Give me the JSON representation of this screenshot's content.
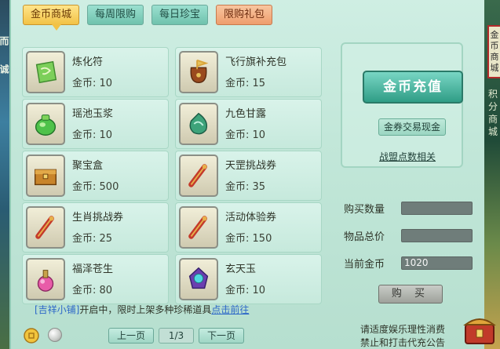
{
  "edges": {
    "left_deco_top": "而",
    "left_deco_mid": "诚",
    "right_tag": "金币商城",
    "right_strip": "积分商城"
  },
  "tabs": [
    {
      "label": "金币商城",
      "state": "active"
    },
    {
      "label": "每周限购",
      "state": "normal"
    },
    {
      "label": "每日珍宝",
      "state": "normal"
    },
    {
      "label": "限购礼包",
      "state": "highlight"
    }
  ],
  "currency_label": "金币:",
  "items": [
    {
      "name": "炼化符",
      "price": "10",
      "icon": "green-talisman-icon"
    },
    {
      "name": "飞行旗补充包",
      "price": "15",
      "icon": "flag-pouch-icon"
    },
    {
      "name": "瑶池玉浆",
      "price": "10",
      "icon": "green-jade-jar-icon"
    },
    {
      "name": "九色甘露",
      "price": "10",
      "icon": "nine-color-dew-icon"
    },
    {
      "name": "聚宝盒",
      "price": "500",
      "icon": "treasure-box-icon"
    },
    {
      "name": "天罡挑战券",
      "price": "35",
      "icon": "scroll-icon"
    },
    {
      "name": "生肖挑战券",
      "price": "25",
      "icon": "scroll-icon"
    },
    {
      "name": "活动体验券",
      "price": "150",
      "icon": "scroll-icon"
    },
    {
      "name": "福泽苍生",
      "price": "80",
      "icon": "pink-potion-icon"
    },
    {
      "name": "玄天玉",
      "price": "10",
      "icon": "purple-jade-icon"
    }
  ],
  "side": {
    "recharge_label": "金币充值",
    "exchange_label": "金券交易现金",
    "alliance_label": "战盟点数相关"
  },
  "form": {
    "quantity_label": "购买数量",
    "quantity_value": "",
    "total_label": "物品总价",
    "total_value": "",
    "balance_label": "当前金币",
    "balance_value": "1020",
    "buy_label": "购 买"
  },
  "notice": {
    "shop": "[吉祥小铺]",
    "text": "开启中，限时上架多种珍稀道具",
    "link": "点击前往"
  },
  "pager": {
    "prev": "上一页",
    "page": "1/3",
    "next": "下一页"
  },
  "warning": {
    "line1": "请适度娱乐理性消费",
    "line2": "禁止和打击代充公告"
  },
  "colors": {
    "panel_bg": "#c2e7d9",
    "tab_active": "#f2c246",
    "tab_teal": "#6fc2ad",
    "tab_orange": "#ee9d6d",
    "recharge": "#2f9d86",
    "link_blue": "#2d67c8"
  }
}
